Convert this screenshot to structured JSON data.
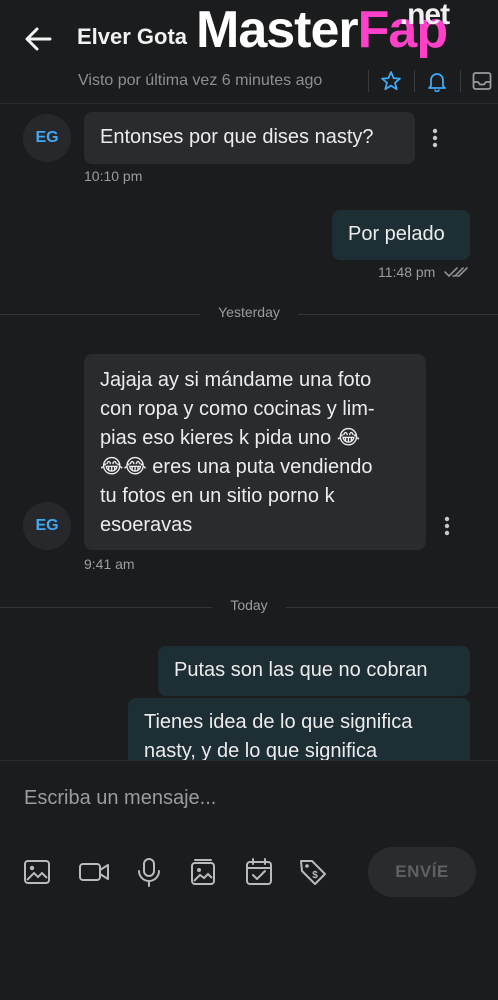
{
  "header": {
    "contact_name": "Elver Gota",
    "last_seen": "Visto por última vez 6 minutes ago"
  },
  "watermark": {
    "part1": "Master",
    "part2": "Fap",
    "part3": ".net"
  },
  "messages": [
    {
      "direction": "in",
      "avatar": "EG",
      "text": "Entonses por que dises nasty?",
      "time": "10:10 pm"
    },
    {
      "direction": "out",
      "text": "Por pelado",
      "time": "11:48 pm"
    },
    {
      "direction": "in",
      "avatar": "EG",
      "lines": [
        "Jajaja ay si mándame una foto",
        "con ropa y como cocinas y lim-",
        "pias eso kieres k pida uno 😂",
        "😂😂 eres una puta vendiendo",
        "tu fotos en un sitio porno k",
        "esoeravas"
      ],
      "time": "9:41 am"
    },
    {
      "direction": "out",
      "text": "Putas son las que no cobran"
    },
    {
      "direction": "out",
      "lines": [
        "Tienes idea de lo que significa",
        "nasty, y de lo que significa"
      ]
    }
  ],
  "dividers": {
    "yesterday": "Yesterday",
    "today": "Today"
  },
  "composer": {
    "placeholder": "Escriba un mensaje...",
    "send_label": "ENVÍE"
  },
  "icons": [
    "back-arrow-icon",
    "star-icon",
    "bell-icon",
    "archive-icon",
    "image-icon",
    "video-icon",
    "microphone-icon",
    "gallery-icon",
    "calendar-check-icon",
    "price-tag-icon",
    "more-vertical-icon",
    "double-check-icon"
  ],
  "colors": {
    "background": "#1b1c1e",
    "accent": "#3fa9f5",
    "incoming_bubble": "#2a2b2e",
    "outgoing_bubble": "#1e2e35"
  }
}
